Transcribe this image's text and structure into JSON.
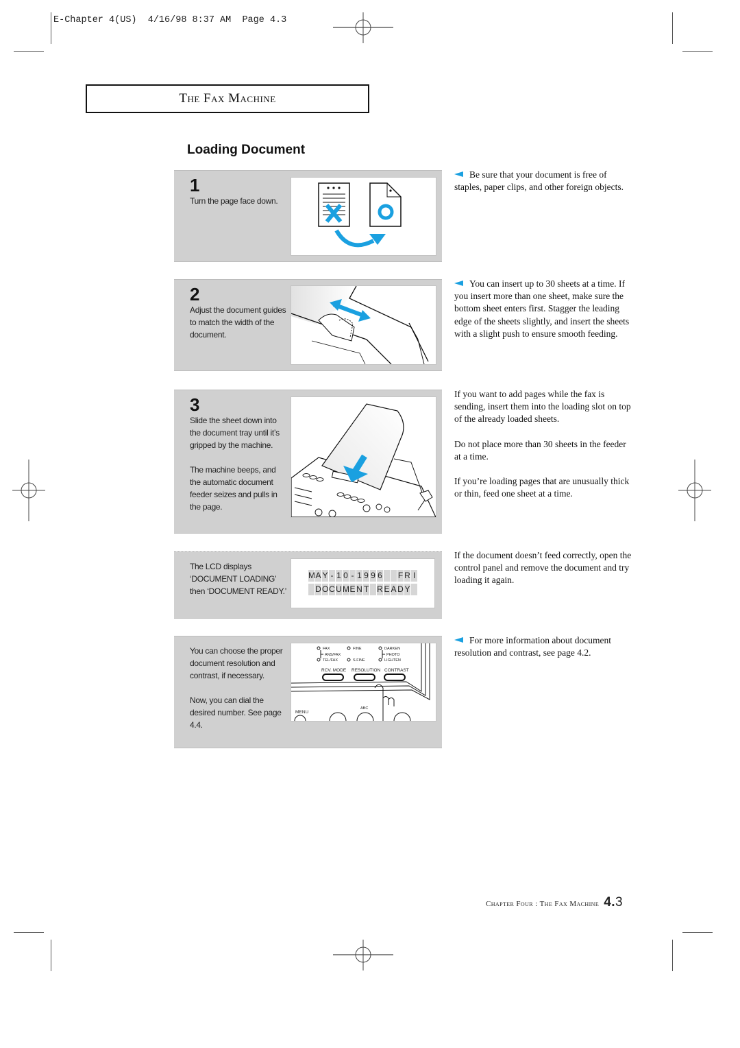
{
  "slug": {
    "text": "E-Chapter 4(US)  4/16/98 8:37 AM  Page 4.3"
  },
  "header": {
    "title": "The Fax Machine"
  },
  "section": {
    "title": "Loading Document"
  },
  "steps": [
    {
      "number": "1",
      "paragraphs": [
        "Turn the page face down."
      ],
      "illustration": "page-face-down-illustration"
    },
    {
      "number": "2",
      "paragraphs": [
        "Adjust the document guides to match the width of the document."
      ],
      "illustration": "document-guides-illustration"
    },
    {
      "number": "3",
      "paragraphs": [
        "Slide the sheet down into the document tray until it’s gripped by the machine.",
        "The machine beeps, and the automatic document feeder seizes and pulls in the page."
      ],
      "illustration": "insert-sheet-illustration"
    },
    {
      "number": "",
      "paragraphs": [
        "The LCD displays ‘DOCUMENT LOADING’ then ‘DOCUMENT READY.’"
      ],
      "illustration": "lcd-display"
    },
    {
      "number": "",
      "paragraphs": [
        "You can choose the proper document resolution and contrast, if necessary.",
        "Now, you can dial the desired number. See page 4.4."
      ],
      "illustration": "control-panel-illustration"
    }
  ],
  "lcd": {
    "line1": [
      "M",
      "A",
      "Y",
      "-",
      "1",
      "0",
      "-",
      "1",
      "9",
      "9",
      "6",
      " ",
      " ",
      "F",
      "R",
      "I"
    ],
    "line2": [
      " ",
      "D",
      "O",
      "C",
      "U",
      "M",
      "E",
      "N",
      "T",
      " ",
      "R",
      "E",
      "A",
      "D",
      "Y",
      " "
    ]
  },
  "control_panel": {
    "leds": [
      {
        "label": "FAX"
      },
      {
        "label": "ANS/FAX"
      },
      {
        "label": "TEL/FAX"
      },
      {
        "label": "FINE"
      },
      {
        "label": "S.FINE"
      },
      {
        "label": "DARKEN"
      },
      {
        "label": "PHOTO"
      },
      {
        "label": "LIGHTEN"
      }
    ],
    "buttons": [
      "RCV. MODE",
      "RESOLUTION",
      "CONTRAST"
    ],
    "keys": [
      "MENU",
      "ABC"
    ]
  },
  "notes": [
    {
      "pointer": true,
      "paragraphs": [
        "Be sure that your document is free of staples, paper clips, and other foreign objects."
      ]
    },
    {
      "pointer": true,
      "paragraphs": [
        "You can insert up to 30 sheets at a time. If you insert more than one sheet, make sure the bottom sheet enters first. Stagger the leading edge of the sheets slightly, and insert the sheets with a slight push to ensure smooth feeding."
      ]
    },
    {
      "pointer": false,
      "paragraphs": [
        "If you want to add pages while the fax is sending, insert them into the loading slot on top of the already loaded sheets.",
        "Do not place more than 30 sheets in the feeder at a time.",
        "If you’re loading pages that are unusually thick or thin, feed one sheet at a time."
      ]
    },
    {
      "pointer": false,
      "paragraphs": [
        "If the document doesn’t feed correctly, open the control panel and remove the document and try loading it again."
      ]
    },
    {
      "pointer": true,
      "paragraphs": [
        "For more information about document resolution and contrast, see page 4.2."
      ]
    }
  ],
  "footer": {
    "chapter": "Chapter Four : The Fax Machine",
    "page_major": "4.",
    "page_minor": "3"
  },
  "colors": {
    "accent": "#1aa0e0",
    "panel": "#d0d0d0"
  }
}
